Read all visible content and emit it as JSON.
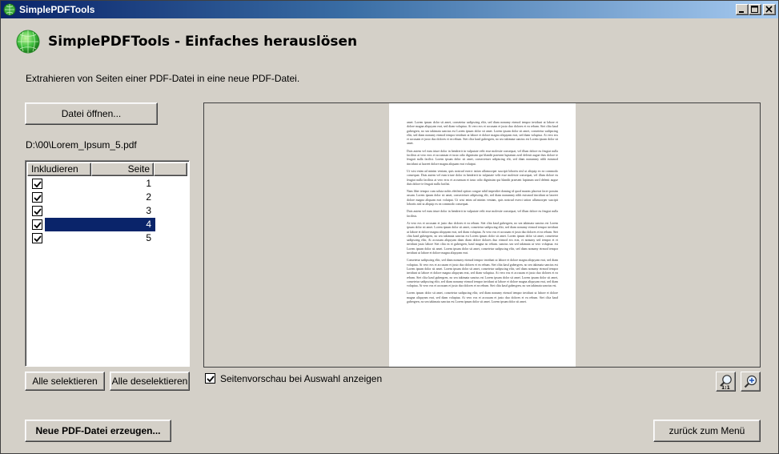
{
  "window": {
    "title": "SimplePDFTools",
    "accent_color": "#0a246a",
    "icon": "globe-app-icon"
  },
  "header": {
    "heading": "SimplePDFTools - Einfaches herauslösen",
    "description": "Extrahieren von Seiten einer PDF-Datei in eine neue PDF-Datei."
  },
  "file": {
    "open_label": "Datei öffnen...",
    "path": "D:\\00\\Lorem_Ipsum_5.pdf"
  },
  "pages_list": {
    "col_include": "Inkludieren",
    "col_page": "Seite",
    "rows": [
      {
        "included": true,
        "page": "1",
        "selected": false
      },
      {
        "included": true,
        "page": "2",
        "selected": false
      },
      {
        "included": true,
        "page": "3",
        "selected": false
      },
      {
        "included": true,
        "page": "4",
        "selected": true
      },
      {
        "included": true,
        "page": "5",
        "selected": false
      }
    ]
  },
  "selection": {
    "select_all_label": "Alle selektieren",
    "deselect_all_label": "Alle deselektieren"
  },
  "preview": {
    "show_on_select_label": "Seitenvorschau bei Auswahl anzeigen",
    "show_on_select_checked": true,
    "zoom_actual_icon": "zoom-actual-size-icon",
    "zoom_in_icon": "zoom-in-icon",
    "page_paragraphs": [
      "amet. Lorem ipsum dolor sit amet, consetetur sadipscing elitr, sed diam nonumy eirmod tempor invidunt ut labore et dolore magna aliquyam erat, sed diam voluptua. At vero eos et accusam et justo duo dolores et ea rebum. Stet clita kasd gubergren, no sea takimata sanctus est Lorem ipsum dolor sit amet. Lorem ipsum dolor sit amet, consetetur sadipscing elitr, sed diam nonumy eirmod tempor invidunt ut labore et dolore magna aliquyam erat, sed diam voluptua. At vero eos et accusam et justo duo dolores et ea rebum. Stet clita kasd gubergren, no sea takimata sanctus est Lorem ipsum dolor sit amet.",
      "Duis autem vel eum iriure dolor in hendrerit in vulputate velit esse molestie consequat, vel illum dolore eu feugiat nulla facilisis at vero eros et accumsan et iusto odio dignissim qui blandit praesent luptatum zzril delenit augue duis dolore te feugait nulla facilisi. Lorem ipsum dolor sit amet, consectetuer adipiscing elit, sed diam nonummy nibh euismod tincidunt ut laoreet dolore magna aliquam erat volutpat.",
      "Ut wisi enim ad minim veniam, quis nostrud exerci tation ullamcorper suscipit lobortis nisl ut aliquip ex ea commodo consequat. Duis autem vel eum iriure dolor in hendrerit in vulputate velit esse molestie consequat, vel illum dolore eu feugiat nulla facilisis at vero eros et accumsan et iusto odio dignissim qui blandit praesent luptatum zzril delenit augue duis dolore te feugait nulla facilisi.",
      "Nam liber tempor cum soluta nobis eleifend option congue nihil imperdiet doming id quod mazim placerat facer possim assum. Lorem ipsum dolor sit amet, consectetuer adipiscing elit, sed diam nonummy nibh euismod tincidunt ut laoreet dolore magna aliquam erat volutpat. Ut wisi enim ad minim veniam, quis nostrud exerci tation ullamcorper suscipit lobortis nisl ut aliquip ex ea commodo consequat.",
      "Duis autem vel eum iriure dolor in hendrerit in vulputate velit esse molestie consequat, vel illum dolore eu feugiat nulla facilisis.",
      "At vero eos et accusam et justo duo dolores et ea rebum. Stet clita kasd gubergren, no sea takimata sanctus est Lorem ipsum dolor sit amet. Lorem ipsum dolor sit amet, consetetur sadipscing elitr, sed diam nonumy eirmod tempor invidunt ut labore et dolore magna aliquyam erat, sed diam voluptua. At vero eos et accusam et justo duo dolores et ea rebum. Stet clita kasd gubergren, no sea takimata sanctus est Lorem ipsum dolor sit amet. Lorem ipsum dolor sit amet, consetetur sadipscing elitr, At accusam aliquyam diam diam dolore dolores duo eirmod eos erat, et nonumy sed tempor et et invidunt justo labore Stet clita ea et gubergren, kasd magna no rebum. sanctus sea sed takimata ut vero voluptua. est Lorem ipsum dolor sit amet. Lorem ipsum dolor sit amet, consetetur sadipscing elitr, sed diam nonumy eirmod tempor invidunt ut labore et dolore magna aliquyam erat.",
      "Consetetur sadipscing elitr, sed diam nonumy eirmod tempor invidunt ut labore et dolore magna aliquyam erat, sed diam voluptua. At vero eos et accusam et justo duo dolores et ea rebum. Stet clita kasd gubergren, no sea takimata sanctus est Lorem ipsum dolor sit amet. Lorem ipsum dolor sit amet, consetetur sadipscing elitr, sed diam nonumy eirmod tempor invidunt ut labore et dolore magna aliquyam erat, sed diam voluptua. At vero eos et accusam et justo duo dolores et ea rebum. Stet clita kasd gubergren, no sea takimata sanctus est Lorem ipsum dolor sit amet. Lorem ipsum dolor sit amet, consetetur sadipscing elitr, sed diam nonumy eirmod tempor invidunt ut labore et dolore magna aliquyam erat, sed diam voluptua. At vero eos et accusam et justo duo dolores et ea rebum. Stet clita kasd gubergren, no sea takimata sanctus est.",
      "Lorem ipsum dolor sit amet, consetetur sadipscing elitr, sed diam nonumy eirmod tempor invidunt ut labore et dolore magna aliquyam erat, sed diam voluptua. At vero eos et accusam et justo duo dolores et ea rebum. Stet clita kasd gubergren, no sea takimata sanctus est Lorem ipsum dolor sit amet. Lorem ipsum dolor sit amet."
    ]
  },
  "footer": {
    "create_label": "Neue PDF-Datei erzeugen...",
    "back_label": "zurück zum Menü"
  }
}
